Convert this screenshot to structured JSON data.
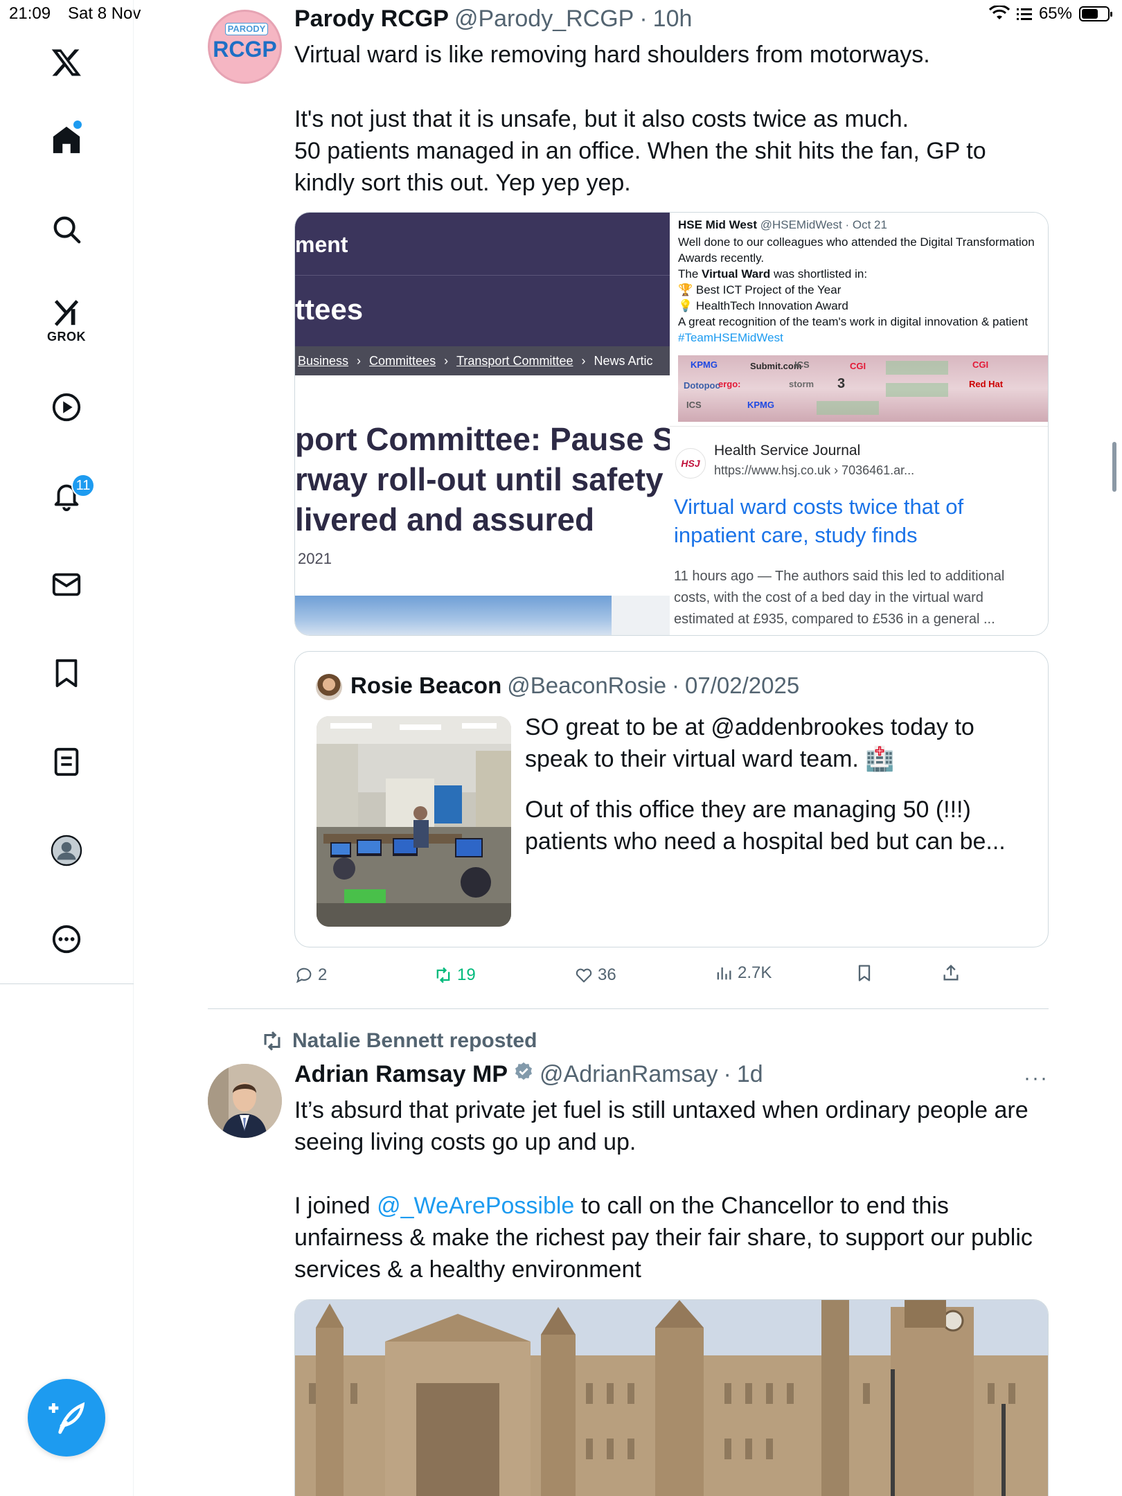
{
  "status_bar": {
    "time": "21:09",
    "date": "Sat 8 Nov",
    "battery": "65%",
    "battery_level": 0.65
  },
  "sidebar": {
    "grok_label": "GROK",
    "notification_count": "11",
    "icons": [
      "x-logo-icon",
      "home-icon",
      "search-icon",
      "grok-icon",
      "video-icon",
      "bell-icon",
      "mail-icon",
      "bookmark-icon",
      "lists-icon",
      "profile-icon",
      "more-icon"
    ]
  },
  "tweet1": {
    "avatar_text_top": "PARODY",
    "avatar_text_main": "RCGP",
    "name": "Parody RCGP",
    "handle": "@Parody_RCGP",
    "sep": "·",
    "time": "10h",
    "text_line1": "Virtual ward is like removing hard shoulders from motorways.",
    "text_line2": "It's not just that it is unsafe, but it also costs twice as much.",
    "text_line3": "50 patients managed in an office. When the shit hits the fan, GP to",
    "text_line4": "kindly sort this out. Yep yep yep.",
    "media_left": {
      "word1": "ment",
      "word2": "ttees",
      "crumbs": [
        "Business",
        "Committees",
        "Transport Committee",
        "News Artic"
      ],
      "headline1": "port Committee: Pause S",
      "headline2": "rway roll-out until safety",
      "headline3": "livered and assured",
      "date": "2021"
    },
    "media_right": {
      "hse_name": "HSE Mid West",
      "hse_handle_date": "@HSEMidWest · Oct 21",
      "hse_line1": "Well done to our colleagues who attended the Digital Transformation",
      "hse_line2": "Awards recently.",
      "hse_line3_pre": "The ",
      "hse_line3_bold": "Virtual Ward",
      "hse_line3_post": " was shortlisted in:",
      "hse_line4": "🏆 Best ICT Project of the Year",
      "hse_line5": "💡 HealthTech Innovation Award",
      "hse_line6": "A great recognition of the team's work in digital innovation & patient",
      "hse_tag": "#TeamHSEMidWest",
      "sponsor_logos": [
        "KPMG",
        "Submit.com",
        "ICS",
        "CGI",
        "ergo:",
        "storm",
        "Dotopoc",
        "Red Hat",
        "3",
        "KPMG",
        "ICS",
        "CGI"
      ],
      "hsj_logo": "HSJ",
      "hsj_source": "Health Service Journal",
      "hsj_url": "https://www.hsj.co.uk › 7036461.ar...",
      "hsj_title_line1": "Virtual ward costs twice that of",
      "hsj_title_line2": "inpatient care, study finds",
      "hsj_snippet_line1": "11 hours ago — The authors said this led to additional",
      "hsj_snippet_line2": "costs, with the cost of a bed day in the virtual ward",
      "hsj_snippet_line3": "estimated at £935, compared to £536 in a general ..."
    },
    "quote": {
      "name": "Rosie Beacon",
      "handle": "@BeaconRosie",
      "sep": "·",
      "date": "07/02/2025",
      "text_line1": "SO great to be at @addenbrookes today to",
      "text_line2": "speak to their virtual ward team. 🏥",
      "text_line3": "Out of this office they are managing 50 (!!!)",
      "text_line4": "patients who need a hospital bed but can be..."
    },
    "actions": {
      "replies": "2",
      "reposts": "19",
      "likes": "36",
      "views": "2.7K"
    }
  },
  "tweet2": {
    "repost_by": "Natalie Bennett reposted",
    "name": "Adrian Ramsay MP",
    "handle": "@AdrianRamsay",
    "sep": "·",
    "time": "1d",
    "more": "···",
    "text_line1": "It’s absurd that private jet fuel is still untaxed when ordinary people are",
    "text_line2": "seeing living costs go up and up.",
    "text_line3_pre": "I joined ",
    "text_line3_link": "@_WeArePossible",
    "text_line3_post": " to call on the Chancellor to end this",
    "text_line4": "unfairness & make the richest pay their fair share, to support our public",
    "text_line5": "services & a healthy environment"
  },
  "colors": {
    "accent": "#1d9bf0",
    "repost_green": "#00ba7c",
    "muted": "#536471"
  }
}
